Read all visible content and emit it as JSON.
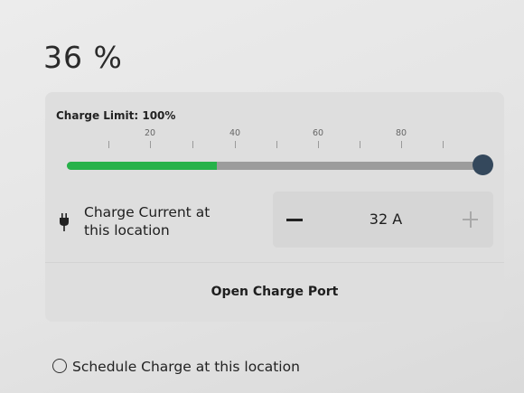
{
  "battery": {
    "percent_text": "36 %"
  },
  "charge_limit": {
    "label": "Charge Limit: 100%",
    "value_percent": 100,
    "current_soc_fraction": 0.36,
    "tick_labels": [
      "20",
      "40",
      "60",
      "80"
    ]
  },
  "charge_current": {
    "label_line1": "Charge Current at",
    "label_line2": "this location",
    "value": "32 A"
  },
  "actions": {
    "open_port_label": "Open Charge Port"
  },
  "schedule": {
    "label": "Schedule Charge at this location"
  },
  "colors": {
    "fill": "#27b24a",
    "knob": "#34485c",
    "track": "#9c9c9c"
  },
  "icons": {
    "plug": "plug-icon",
    "decrease": "minus-icon",
    "increase": "plus-icon",
    "schedule": "clock-icon"
  }
}
